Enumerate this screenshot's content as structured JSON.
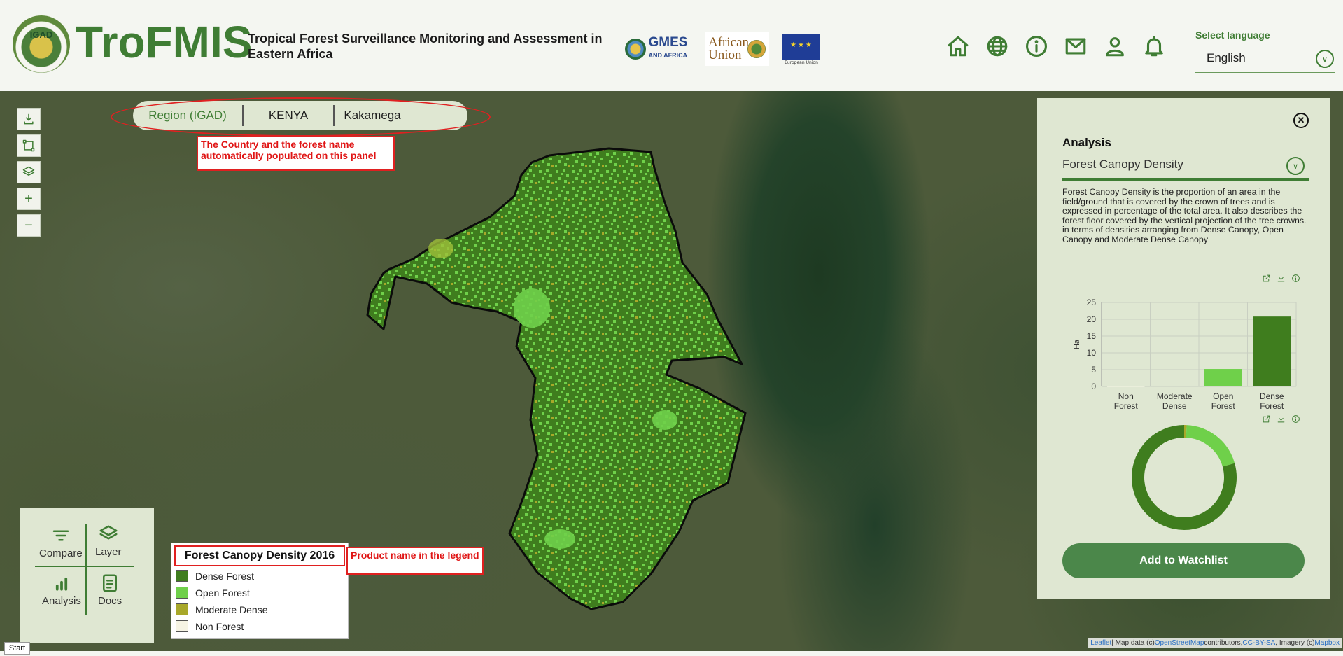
{
  "header": {
    "logo_text": "IGAD",
    "brand": "TroFMIS",
    "subtitle": "Tropical Forest Surveillance Monitoring and Assessment in Eastern Africa",
    "partners": {
      "gmes": "GMES",
      "gmes_sub": "AND AFRICA",
      "au": "African Union",
      "eu": "European Union"
    },
    "icons": [
      "home-icon",
      "globe-icon",
      "info-icon",
      "mail-icon",
      "user-icon",
      "bell-icon"
    ],
    "language_label": "Select language",
    "language_value": "English"
  },
  "breadcrumb": {
    "region": "Region (IGAD)",
    "country": "KENYA",
    "forest": "Kakamega"
  },
  "annotations": {
    "breadcrumb_note": "The Country and the forest name automatically populated on this panel",
    "legend_note": "Product name in the legend"
  },
  "left_panel": {
    "compare": "Compare",
    "layer": "Layer",
    "analysis": "Analysis",
    "docs": "Docs"
  },
  "map_tools": [
    "download-icon",
    "draw-rectangle-icon",
    "layers-icon",
    "+",
    "−"
  ],
  "legend": {
    "title": "Forest Canopy Density 2016",
    "items": [
      {
        "label": "Dense Forest",
        "color": "#3f7d1e"
      },
      {
        "label": "Open Forest",
        "color": "#6fd04a"
      },
      {
        "label": "Moderate Dense",
        "color": "#a8a82a"
      },
      {
        "label": "Non Forest",
        "color": "#f6f4e4"
      }
    ]
  },
  "start_label": "Start",
  "attribution": {
    "leaflet": "Leaflet",
    "text1": " | Map data (c) ",
    "osm": "OpenStreetMap",
    "text2": " contributors, ",
    "license": "CC-BY-SA",
    "text3": ", Imagery (c) ",
    "mapbox": "Mapbox"
  },
  "analysis_panel": {
    "heading": "Analysis",
    "selected": "Forest Canopy Density",
    "description": "Forest Canopy Density is the proportion of an area in the field/ground that is covered by the crown of trees and is expressed in percentage of the total area. It also describes the forest floor covered by the vertical projection of the tree crowns. in terms of densities arranging from Dense Canopy, Open Canopy and Moderate Dense Canopy",
    "button": "Add to Watchlist"
  },
  "chart_data": [
    {
      "type": "bar",
      "categories": [
        "Non Forest",
        "Moderate Dense",
        "Open Forest",
        "Dense Forest"
      ],
      "values": [
        0,
        0.2,
        5.2,
        20.8
      ],
      "colors": [
        "#f6f4e4",
        "#a8a82a",
        "#6fd04a",
        "#3f7d1e"
      ],
      "ylabel": "Ha",
      "yticks": [
        0,
        5,
        10,
        15,
        20,
        25
      ],
      "ylim": [
        0,
        25
      ],
      "grid": true
    },
    {
      "type": "pie",
      "style": "donut",
      "categories": [
        "Non Forest",
        "Moderate Dense",
        "Open Forest",
        "Dense Forest"
      ],
      "values": [
        0,
        0.2,
        5.2,
        20.8
      ],
      "colors": [
        "#f6f4e4",
        "#a8a82a",
        "#6fd04a",
        "#3f7d1e"
      ]
    }
  ]
}
